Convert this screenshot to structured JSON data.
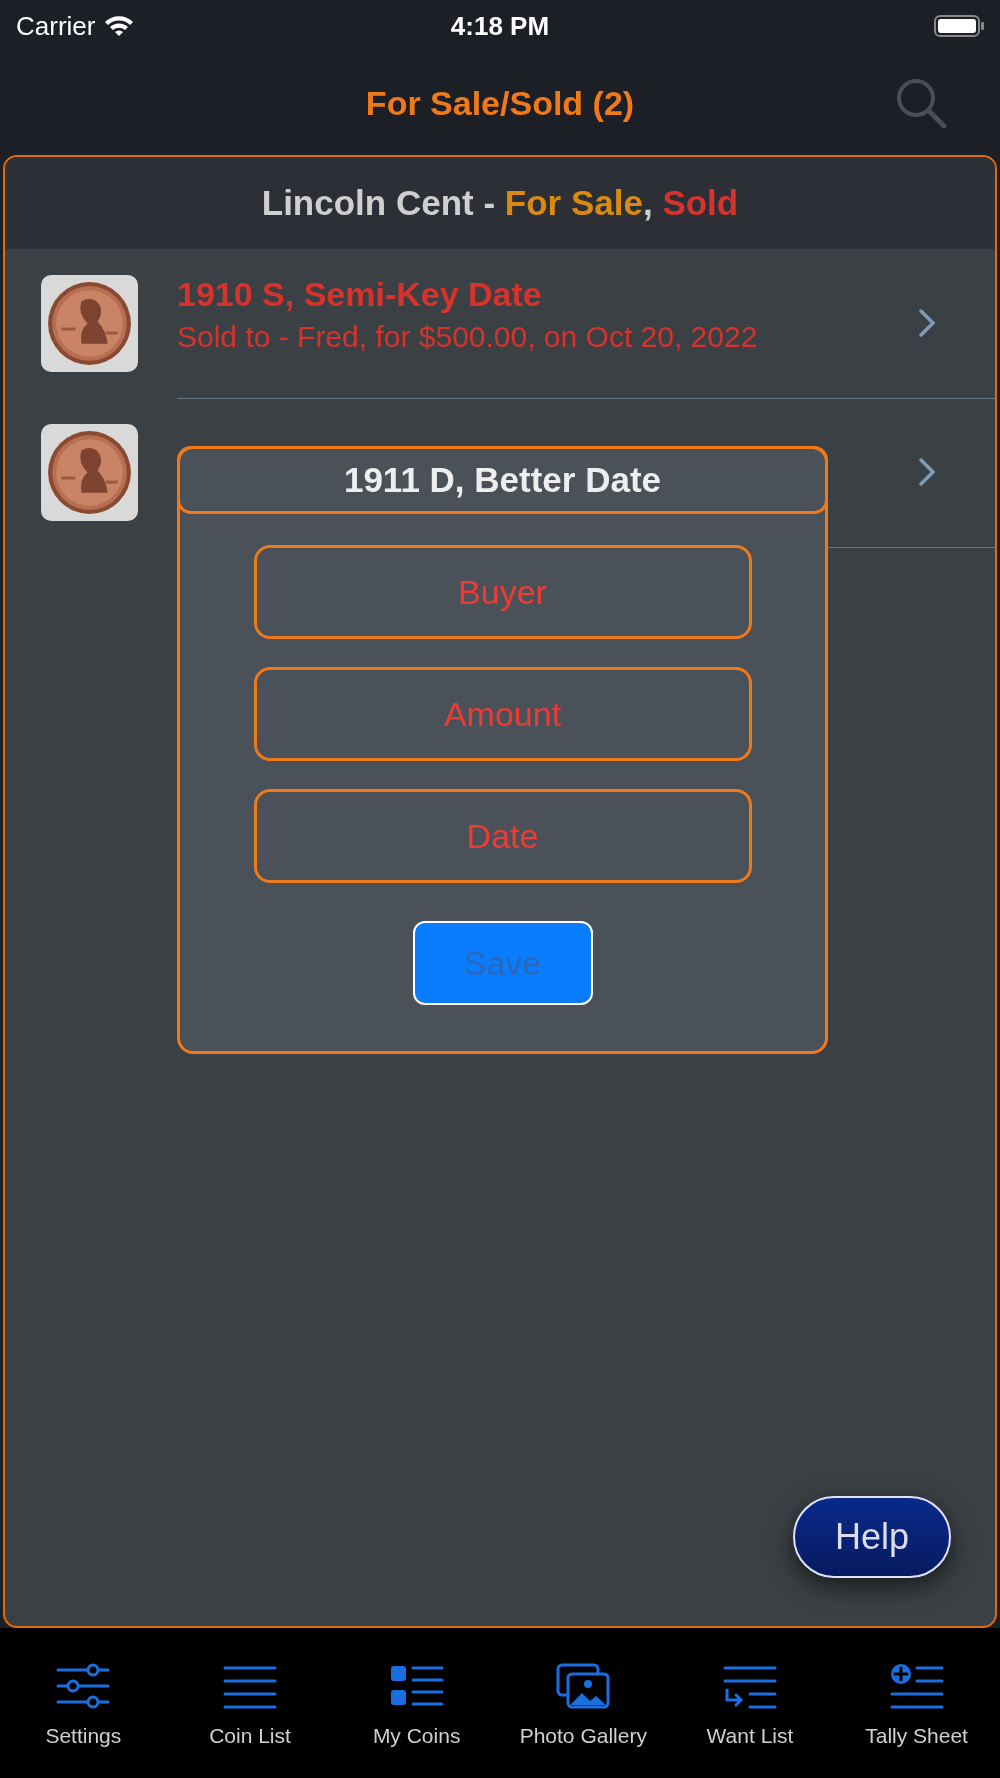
{
  "status_bar": {
    "carrier": "Carrier",
    "time": "4:18 PM"
  },
  "nav": {
    "title": "For Sale/Sold (2)"
  },
  "section_header": [
    {
      "text": "Lincoln Cent - ",
      "kind": "plain"
    },
    {
      "text": "For Sale",
      "kind": "for_sale"
    },
    {
      "text": ",",
      "kind": "plain"
    },
    {
      "text": " Sold",
      "kind": "sold"
    }
  ],
  "rows": [
    {
      "kind": "sold",
      "title": "1910 S, Semi-Key Date",
      "subtitle": "Sold to - Fred, for $500.00, on Oct 20, 2022"
    },
    {}
  ],
  "dialog": {
    "title": "1911 D, Better Date",
    "fields": [
      {
        "placeholder": "Buyer"
      },
      {
        "placeholder": "Amount"
      },
      {
        "placeholder": "Date"
      }
    ],
    "save": {
      "label": "Save",
      "disabled": true
    }
  },
  "help_button": "Help",
  "tabs": [
    {
      "label": "Settings"
    },
    {
      "label": "Coin List"
    },
    {
      "label": "My Coins"
    },
    {
      "label": "Photo Gallery"
    },
    {
      "label": "Want List"
    },
    {
      "label": "Tally Sheet"
    }
  ]
}
